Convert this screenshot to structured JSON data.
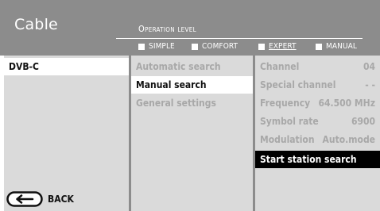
{
  "header": {
    "title": "Cable",
    "operation_level_label": "Operation level",
    "modes": [
      {
        "label": "SIMPLE",
        "selected": false
      },
      {
        "label": "COMFORT",
        "selected": false
      },
      {
        "label": "EXPERT",
        "selected": true
      },
      {
        "label": "MANUAL",
        "selected": false
      }
    ]
  },
  "left_menu": {
    "items": [
      {
        "label": "DVB-C",
        "active": true
      }
    ],
    "back_label": "BACK"
  },
  "middle_menu": {
    "items": [
      {
        "label": "Automatic search",
        "active": false
      },
      {
        "label": "Manual search",
        "active": true
      },
      {
        "label": "General settings",
        "active": false
      }
    ]
  },
  "right_menu": {
    "items": [
      {
        "label": "Channel",
        "value": "04"
      },
      {
        "label": "Special channel",
        "value": "- -"
      },
      {
        "label": "Frequency",
        "value": "64.500 MHz"
      },
      {
        "label": "Symbol rate",
        "value": "6900"
      },
      {
        "label": "Modulation",
        "value": "Auto.mode"
      }
    ],
    "action_label": "Start station search"
  },
  "colors": {
    "header_bg": "#8c8c8c",
    "panel_bg": "#dadada",
    "inactive_text": "#a8a8a8",
    "highlight_bg": "#000000"
  }
}
